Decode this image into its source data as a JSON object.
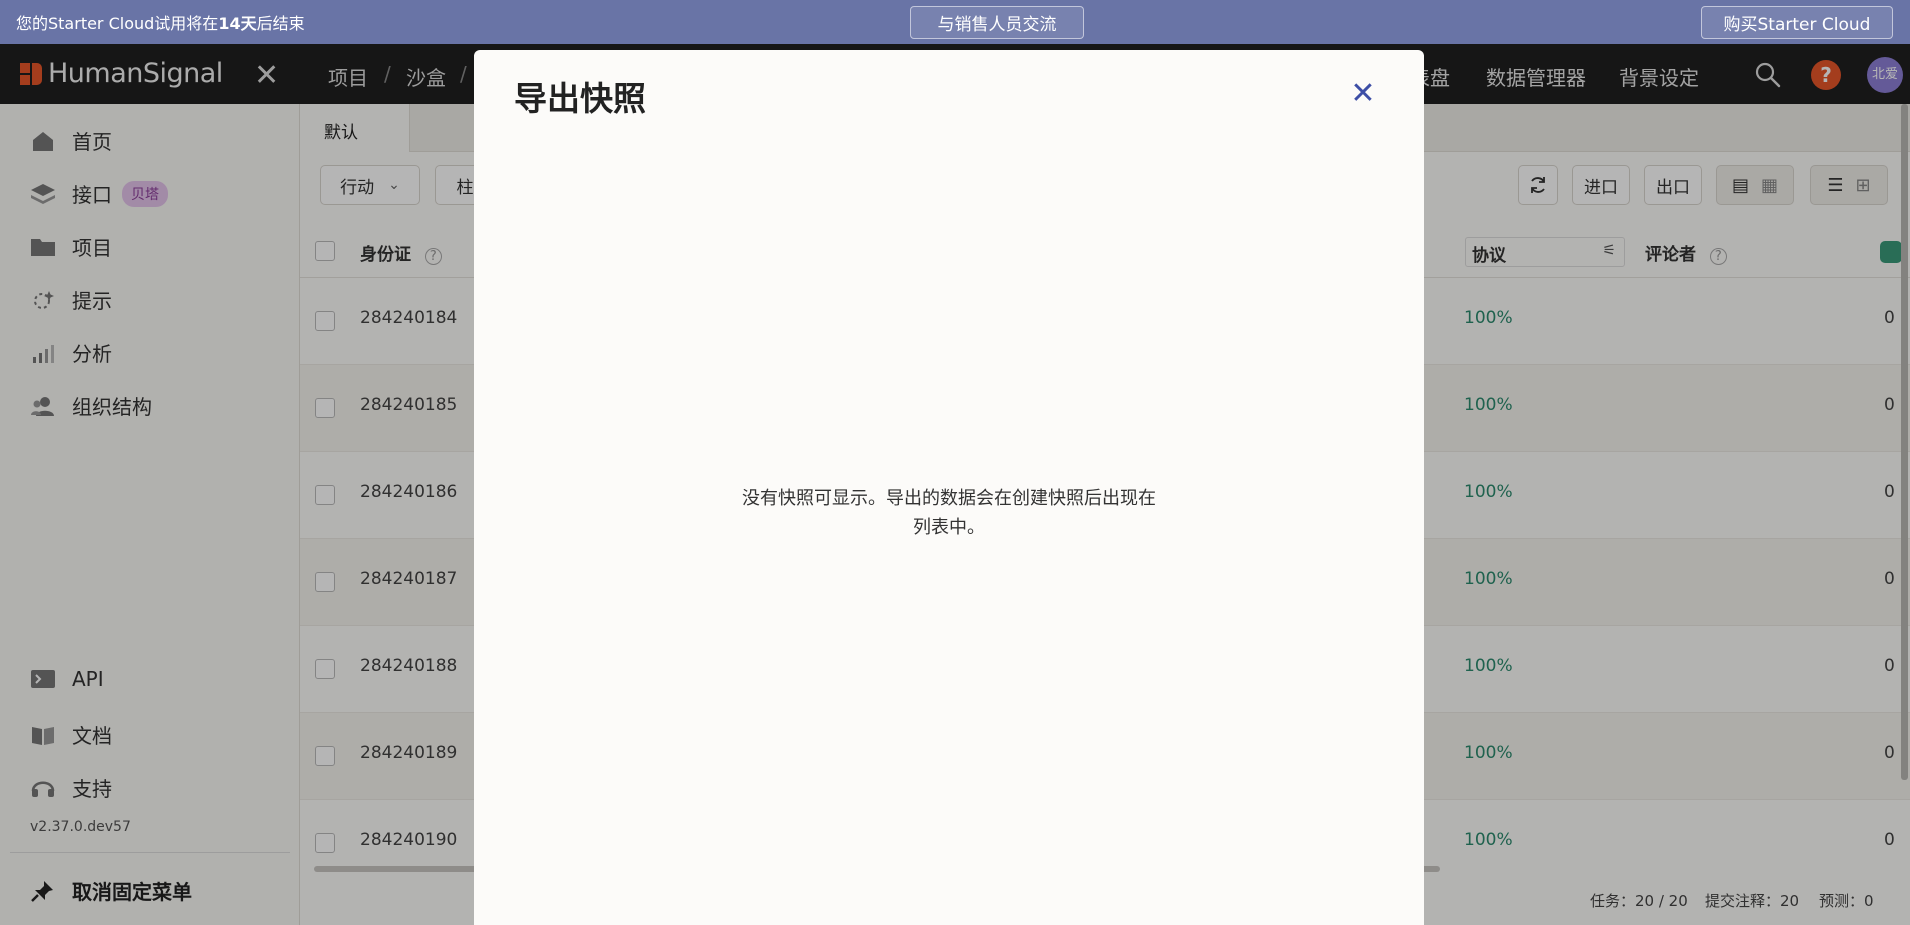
{
  "banner": {
    "text_prefix": "您的Starter Cloud试用将在",
    "days": "14天",
    "text_suffix": "后结束",
    "contact_label": "与销售人员交流",
    "buy_label": "购买Starter Cloud"
  },
  "nav": {
    "logo": "HumanSignal",
    "breadcrumbs": [
      "项目",
      "沙盒"
    ],
    "links": [
      "表盘",
      "数据管理器",
      "背景设定"
    ],
    "avatar_initials": "北爱",
    "help_glyph": "?"
  },
  "sidebar": {
    "items": [
      {
        "label": "首页",
        "icon": "home-icon"
      },
      {
        "label": "接口",
        "icon": "stack-icon",
        "badge": "贝塔"
      },
      {
        "label": "项目",
        "icon": "folder-icon"
      },
      {
        "label": "提示",
        "icon": "sparkle-icon"
      },
      {
        "label": "分析",
        "icon": "bar-chart-icon"
      },
      {
        "label": "组织结构",
        "icon": "people-icon"
      }
    ],
    "bottom_items": [
      {
        "label": "API",
        "icon": "terminal-icon"
      },
      {
        "label": "文档",
        "icon": "book-icon"
      },
      {
        "label": "支持",
        "icon": "headset-icon"
      }
    ],
    "version": "v2.37.0.dev57",
    "unpin_label": "取消固定菜单"
  },
  "main": {
    "tab_label": "默认",
    "toolbar": {
      "actions_label": "行动",
      "columns_label": "柱",
      "import_label": "进口",
      "export_label": "出口"
    },
    "columns": {
      "id": "身份证",
      "agreement": "协议",
      "reviewers": "评论者"
    },
    "rows": [
      {
        "id": "284240184",
        "agreement": "100%",
        "count": "0"
      },
      {
        "id": "284240185",
        "agreement": "100%",
        "count": "0"
      },
      {
        "id": "284240186",
        "agreement": "100%",
        "count": "0"
      },
      {
        "id": "284240187",
        "agreement": "100%",
        "count": "0"
      },
      {
        "id": "284240188",
        "agreement": "100%",
        "count": "0"
      },
      {
        "id": "284240189",
        "agreement": "100%",
        "count": "0"
      },
      {
        "id": "284240190",
        "agreement": "100%",
        "count": "0"
      }
    ],
    "stats": {
      "tasks": "任务：20 / 20",
      "submitted": "提交注释：20",
      "predictions": "预测：0"
    }
  },
  "modal": {
    "title": "导出快照",
    "empty_line1": "没有快照可显示。导出的数据会在创建快照后出现在",
    "empty_line2": "列表中。"
  },
  "colors": {
    "banner": "#6974a6",
    "nav": "#1f1f1f",
    "accent_orange": "#e8562a",
    "agreement_green": "#2c8a6e",
    "modal_close": "#3d4ea6"
  }
}
